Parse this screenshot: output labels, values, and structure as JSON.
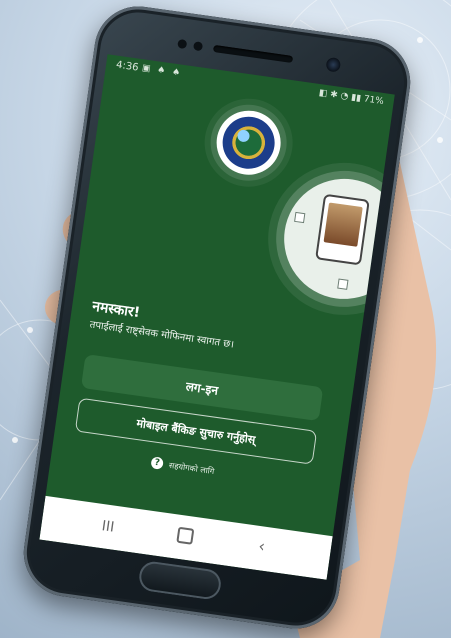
{
  "status": {
    "time": "4:36",
    "battery": "71%",
    "left_icons": "▣ ♠ ♠",
    "right_icons": "◧ ✱ ◔ ▮▮"
  },
  "main": {
    "greeting": "नमस्कार!",
    "subtitle": "तपाईलाई राष्ट्सेवक मोफिनमा स्वागत छ।",
    "login_label": "लग-इन",
    "mobile_banking_label": "मोबाइल बैंकिङ सुचारु गर्नुहोस्",
    "help_text": "सहयोगको लागि",
    "help_icon_glyph": "?"
  },
  "navbar": {
    "recent_glyph": "III",
    "back_glyph": "‹"
  },
  "colors": {
    "screen_bg": "#1e5b2c",
    "button_fill": "#2f6e3d"
  },
  "icons": {
    "logo": "organization-emblem-icon",
    "illustration": "phone-profile-icon",
    "help": "question-circle-icon"
  }
}
